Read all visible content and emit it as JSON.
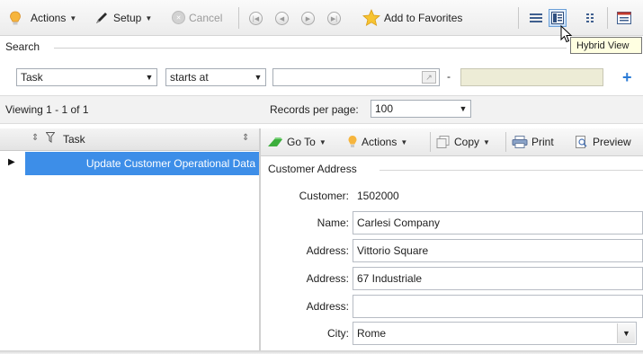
{
  "toolbar": {
    "actions_label": "Actions",
    "setup_label": "Setup",
    "cancel_label": "Cancel",
    "favorites_label": "Add to Favorites"
  },
  "tooltip": {
    "text": "Hybrid View"
  },
  "search": {
    "section_label": "Search",
    "field_value": "Task",
    "operator_value": "starts at",
    "value1": "",
    "value2": "",
    "range_separator": "-"
  },
  "paging": {
    "viewing_text": "Viewing 1 - 1  of 1",
    "records_label": "Records per page:",
    "records_value": "100"
  },
  "list": {
    "column_header": "Task",
    "rows": [
      {
        "label": "Update Customer Operational Data"
      }
    ]
  },
  "detail_toolbar": {
    "goto_label": "Go To",
    "actions_label": "Actions",
    "copy_label": "Copy",
    "print_label": "Print",
    "preview_label": "Preview"
  },
  "form": {
    "section_title": "Customer Address",
    "customer_label": "Customer:",
    "customer_value": "1502000",
    "name_label": "Name:",
    "name_value": "Carlesi Company",
    "address1_label": "Address:",
    "address1_value": "Vittorio Square",
    "address2_label": "Address:",
    "address2_value": "67 Industriale",
    "address3_label": "Address:",
    "address3_value": "",
    "city_label": "City:",
    "city_value": "Rome"
  },
  "colors": {
    "selection": "#3d8ee8",
    "accent_blue": "#2a7ad6",
    "toolbar_bg": "#f3f3f3"
  }
}
